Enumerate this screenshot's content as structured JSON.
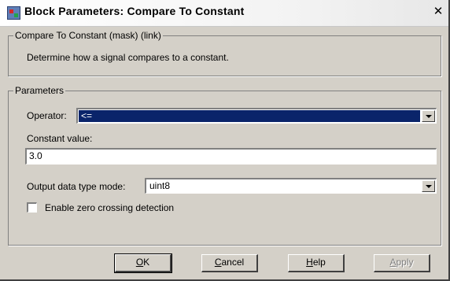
{
  "window": {
    "title": "Block Parameters: Compare To Constant",
    "close_glyph": "✕"
  },
  "description_group": {
    "title": "Compare To Constant (mask) (link)",
    "text": "Determine how a signal compares to a constant."
  },
  "parameters_group": {
    "title": "Parameters",
    "operator_label": "Operator:",
    "operator_value": "<=",
    "constant_label": "Constant value:",
    "constant_value": "3.0",
    "output_type_label": "Output data type mode:",
    "output_type_value": "uint8",
    "zero_crossing_label": "Enable zero crossing detection",
    "zero_crossing_checked": false
  },
  "buttons": {
    "ok": {
      "mnemonic": "O",
      "rest": "K"
    },
    "cancel": {
      "mnemonic": "C",
      "rest": "ancel"
    },
    "help": {
      "mnemonic": "H",
      "rest": "elp"
    },
    "apply": {
      "mnemonic": "A",
      "rest": "pply",
      "disabled": true
    }
  },
  "icons": {
    "app": "block-parameters-icon",
    "close": "close-icon",
    "dropdown": "chevron-down-icon"
  },
  "colors": {
    "selection": "#0a246a",
    "face": "#d4d0c8"
  }
}
